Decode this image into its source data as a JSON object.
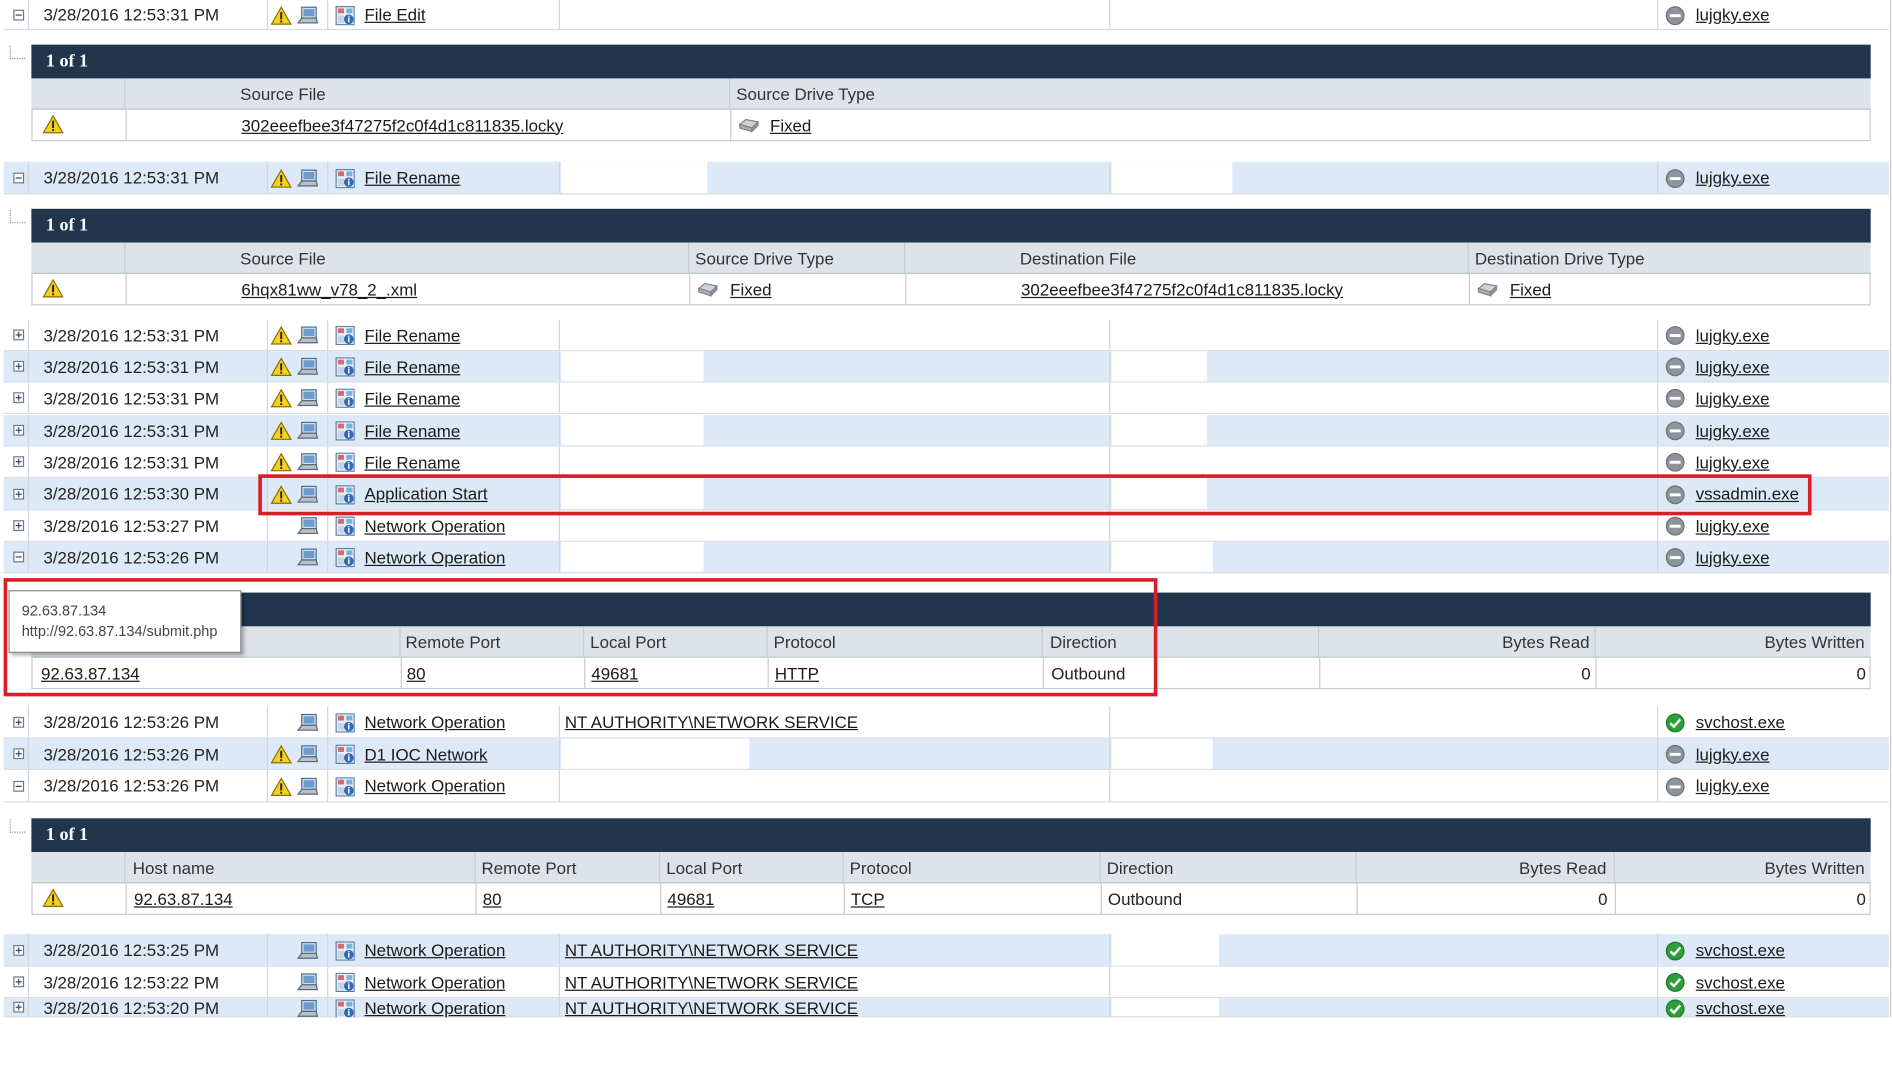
{
  "events": [
    {
      "id": "e1",
      "timestamp": "3/28/2016 12:53:31 PM",
      "expanded": true,
      "warn": true,
      "type": "File Edit",
      "user": "",
      "process": "lujgky.exe",
      "status": "neutral"
    },
    {
      "id": "e2",
      "timestamp": "3/28/2016 12:53:31 PM",
      "expanded": true,
      "warn": true,
      "type": "File Rename",
      "user": "",
      "process": "lujgky.exe",
      "status": "neutral"
    },
    {
      "id": "e3",
      "timestamp": "3/28/2016 12:53:31 PM",
      "expanded": false,
      "warn": true,
      "type": "File Rename",
      "user": "",
      "process": "lujgky.exe",
      "status": "neutral"
    },
    {
      "id": "e4",
      "timestamp": "3/28/2016 12:53:31 PM",
      "expanded": false,
      "warn": true,
      "type": "File Rename",
      "user": "",
      "process": "lujgky.exe",
      "status": "neutral"
    },
    {
      "id": "e5",
      "timestamp": "3/28/2016 12:53:31 PM",
      "expanded": false,
      "warn": true,
      "type": "File Rename",
      "user": "",
      "process": "lujgky.exe",
      "status": "neutral"
    },
    {
      "id": "e6",
      "timestamp": "3/28/2016 12:53:31 PM",
      "expanded": false,
      "warn": true,
      "type": "File Rename",
      "user": "",
      "process": "lujgky.exe",
      "status": "neutral"
    },
    {
      "id": "e7",
      "timestamp": "3/28/2016 12:53:31 PM",
      "expanded": false,
      "warn": true,
      "type": "File Rename",
      "user": "",
      "process": "lujgky.exe",
      "status": "neutral"
    },
    {
      "id": "e8",
      "timestamp": "3/28/2016 12:53:30 PM",
      "expanded": false,
      "warn": true,
      "type": "Application Start",
      "user": "",
      "process": "vssadmin.exe",
      "status": "neutral"
    },
    {
      "id": "e9",
      "timestamp": "3/28/2016 12:53:27 PM",
      "expanded": false,
      "warn": false,
      "type": "Network Operation",
      "user": "",
      "process": "lujgky.exe",
      "status": "neutral"
    },
    {
      "id": "e10",
      "timestamp": "3/28/2016 12:53:26 PM",
      "expanded": true,
      "warn": false,
      "type": "Network Operation",
      "user": "",
      "process": "lujgky.exe",
      "status": "neutral"
    },
    {
      "id": "e11",
      "timestamp": "3/28/2016 12:53:26 PM",
      "expanded": false,
      "warn": false,
      "type": "Network Operation",
      "user": "NT AUTHORITY\\NETWORK SERVICE",
      "process": "svchost.exe",
      "status": "ok"
    },
    {
      "id": "e12",
      "timestamp": "3/28/2016 12:53:26 PM",
      "expanded": false,
      "warn": true,
      "type": "D1 IOC Network",
      "user": "",
      "process": "lujgky.exe",
      "status": "neutral"
    },
    {
      "id": "e13",
      "timestamp": "3/28/2016 12:53:26 PM",
      "expanded": true,
      "warn": true,
      "type": "Network Operation",
      "user": "",
      "process": "lujgky.exe",
      "status": "neutral"
    },
    {
      "id": "e14",
      "timestamp": "3/28/2016 12:53:25 PM",
      "expanded": false,
      "warn": false,
      "type": "Network Operation",
      "user": "NT AUTHORITY\\NETWORK SERVICE",
      "process": "svchost.exe",
      "status": "ok"
    },
    {
      "id": "e15",
      "timestamp": "3/28/2016 12:53:22 PM",
      "expanded": false,
      "warn": false,
      "type": "Network Operation",
      "user": "NT AUTHORITY\\NETWORK SERVICE",
      "process": "svchost.exe",
      "status": "ok"
    },
    {
      "id": "e16",
      "timestamp": "3/28/2016 12:53:20 PM",
      "expanded": false,
      "warn": false,
      "type": "Network Operation",
      "user": "NT AUTHORITY\\NETWORK SERVICE",
      "process": "svchost.exe",
      "status": "ok"
    }
  ],
  "details": {
    "d1": {
      "title": "1 of 1",
      "col_source_file": "Source File",
      "col_source_drive_type": "Source Drive Type",
      "source_file": "302eeefbee3f47275f2c0f4d1c811835.locky",
      "source_drive_type": "Fixed"
    },
    "d2": {
      "title": "1 of 1",
      "col_source_file": "Source File",
      "col_source_drive_type": "Source Drive Type",
      "col_destination_file": "Destination File",
      "col_destination_drive_type": "Destination Drive Type",
      "source_file": "6hqx81ww_v78_2_.xml",
      "source_drive_type": "Fixed",
      "destination_file": "302eeefbee3f47275f2c0f4d1c811835.locky",
      "destination_drive_type": "Fixed"
    },
    "d3": {
      "col_remote_port": "Remote Port",
      "col_local_port": "Local Port",
      "col_protocol": "Protocol",
      "col_direction": "Direction",
      "col_bytes_read": "Bytes Read",
      "col_bytes_written": "Bytes Written",
      "host": "92.63.87.134",
      "remote_port": "80",
      "local_port": "49681",
      "protocol": "HTTP",
      "direction": "Outbound",
      "bytes_read": "0",
      "bytes_written": "0"
    },
    "d4": {
      "title": "1 of 1",
      "col_host_name": "Host name",
      "col_remote_port": "Remote Port",
      "col_local_port": "Local Port",
      "col_protocol": "Protocol",
      "col_direction": "Direction",
      "col_bytes_read": "Bytes Read",
      "col_bytes_written": "Bytes Written",
      "host": "92.63.87.134",
      "remote_port": "80",
      "local_port": "49681",
      "protocol": "TCP",
      "direction": "Outbound",
      "bytes_read": "0",
      "bytes_written": "0"
    }
  },
  "tooltip": {
    "line1": "92.63.87.134",
    "line2": "http://92.63.87.134/submit.php"
  },
  "icons": {
    "warning": "warning-icon",
    "computer": "computer-icon",
    "event": "event-type-icon",
    "status_neutral": "neutral-status-icon",
    "status_ok": "ok-status-icon"
  },
  "colors": {
    "detail_header": "#21354d",
    "alt_row": "#dde9f6",
    "highlight": "#d81e27",
    "ok": "#2e9e3a"
  }
}
